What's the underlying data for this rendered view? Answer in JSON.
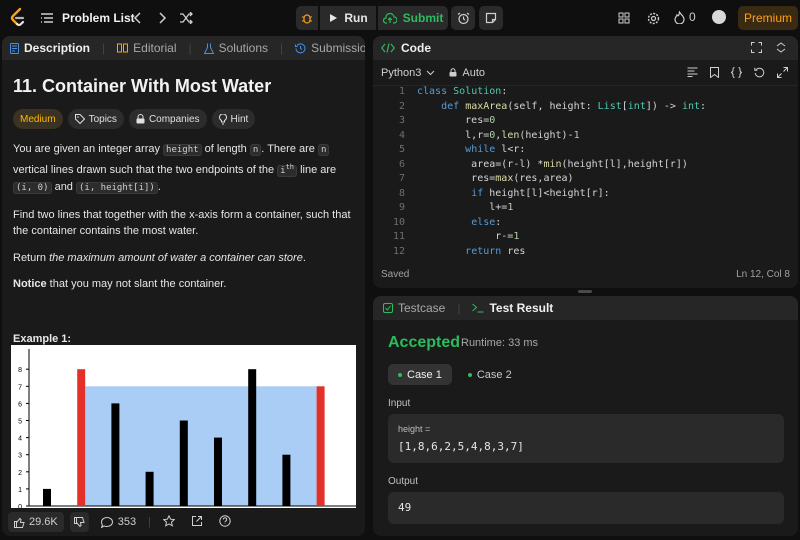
{
  "topbar": {
    "problem_list": "Problem List",
    "run": "Run",
    "submit": "Submit",
    "streak_count": "0",
    "premium": "Premium"
  },
  "left_tabs": [
    "Description",
    "Editorial",
    "Solutions",
    "Submissions"
  ],
  "problem": {
    "title": "11. Container With Most Water",
    "tags": [
      "Medium",
      "Topics",
      "Companies",
      "Hint"
    ],
    "p1_a": "You are given an integer array ",
    "code_height": "height",
    "p1_b": " of length ",
    "code_n": "n",
    "p1_c": ". There are ",
    "p1_d": " vertical lines drawn such that the two endpoints of the ",
    "code_i": "i",
    "sup_th": "th",
    "p1_e": " line are ",
    "code_i0": "(i, 0)",
    "p1_f": " and ",
    "code_ih": "(i, height[i])",
    "p1_g": ".",
    "p2": "Find two lines that together with the x-axis form a container, such that the container contains the most water.",
    "p3_a": "Return ",
    "p3_b": "the maximum amount of water a container can store",
    "p3_c": ".",
    "p4_a": "Notice",
    "p4_b": " that you may not slant the container.",
    "example": "Example 1:",
    "figure": {
      "y_ticks": [
        "0",
        "1",
        "2",
        "3",
        "4",
        "5",
        "6",
        "7",
        "8"
      ],
      "heights": [
        1,
        8,
        6,
        2,
        5,
        4,
        8,
        3,
        7
      ],
      "highlighted": [
        1,
        8
      ]
    }
  },
  "bottombar": {
    "likes": "29.6K",
    "comments": "353"
  },
  "code": {
    "header": "Code",
    "language": "Python3",
    "auto": "Auto",
    "lines": [
      [
        "1",
        "class Solution:"
      ],
      [
        "2",
        "    def maxArea(self, height: List[int]) -> int:"
      ],
      [
        "3",
        "        res=0"
      ],
      [
        "4",
        "        l,r=0,len(height)-1"
      ],
      [
        "5",
        "        while l<r:"
      ],
      [
        "6",
        "         area=(r-l) *min(height[l],height[r])"
      ],
      [
        "7",
        "         res=max(res,area)"
      ],
      [
        "8",
        "         if height[l]<height[r]:"
      ],
      [
        "9",
        "            l+=1"
      ],
      [
        "10",
        "         else:"
      ],
      [
        "11",
        "             r-=1"
      ],
      [
        "12",
        "        return res"
      ]
    ],
    "saved": "Saved",
    "position": "Ln 12, Col 8"
  },
  "result": {
    "tabs": [
      "Testcase",
      "Test Result"
    ],
    "status": "Accepted",
    "runtime": "Runtime: 33 ms",
    "cases": [
      "Case 1",
      "Case 2"
    ],
    "input_label": "Input",
    "param_label": "height =",
    "param_value": "[1,8,6,2,5,4,8,3,7]",
    "output_label": "Output",
    "output_value": "49"
  }
}
